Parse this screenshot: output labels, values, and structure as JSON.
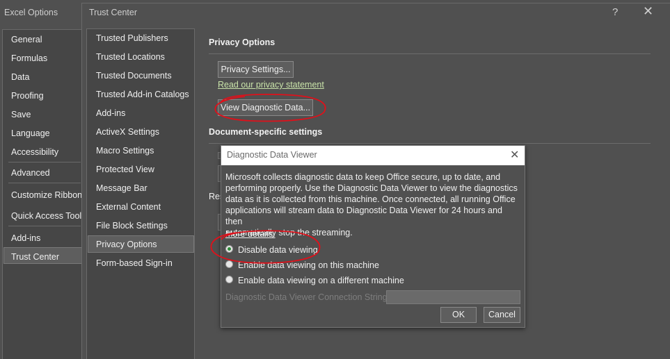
{
  "excel_options": {
    "title": "Excel Options",
    "nav": [
      "General",
      "Formulas",
      "Data",
      "Proofing",
      "Save",
      "Language",
      "Accessibility",
      "Advanced",
      "Customize Ribbon",
      "Quick Access Toolbar",
      "Add-ins",
      "Trust Center"
    ],
    "selected": "Trust Center"
  },
  "trust_center": {
    "title": "Trust Center",
    "help_glyph": "?",
    "close_glyph": "✕",
    "nav": [
      "Trusted Publishers",
      "Trusted Locations",
      "Trusted Documents",
      "Trusted Add-in Catalogs",
      "Add-ins",
      "ActiveX Settings",
      "Macro Settings",
      "Protected View",
      "Message Bar",
      "External Content",
      "File Block Settings",
      "Privacy Options",
      "Form-based Sign-in"
    ],
    "selected": "Privacy Options"
  },
  "privacy": {
    "heading": "Privacy Options",
    "settings_button": "Privacy Settings...",
    "statement_link": "Read our privacy statement",
    "view_diag_button": "View Diagnostic Data...",
    "doc_heading": "Document-specific settings",
    "res_heading_fragment": "Res"
  },
  "diagnostic_dialog": {
    "title": "Diagnostic Data Viewer",
    "close_glyph": "✕",
    "body_lines": [
      "Microsoft collects diagnostic data to keep Office secure, up to date, and",
      "performing properly. Use the Diagnostic Data Viewer to view the diagnostics",
      "data as it is collected from this machine. Once connected, all running Office",
      "applications will stream data to Diagnostic Data Viewer for 24 hours and then",
      "automatically stop the streaming."
    ],
    "more_details_link": "More details.",
    "options": [
      "Disable data viewing",
      "Enable data viewing on this machine",
      "Enable data viewing on a different machine"
    ],
    "selected_option": "Disable data viewing",
    "connection_label": "Diagnostic Data Viewer Connection String",
    "connection_value": "",
    "ok_label": "OK",
    "cancel_label": "Cancel"
  },
  "colors": {
    "annotation_red": "#e0101a",
    "link_green": "#c9e3a9",
    "radio_selected": "#2e8b3a"
  }
}
